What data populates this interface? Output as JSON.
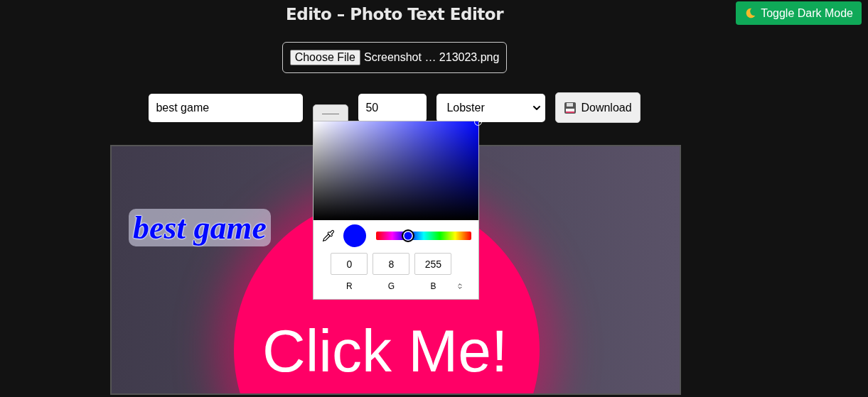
{
  "header": {
    "title": "Edito – Photo Text Editor",
    "theme_button": "Toggle Dark Mode"
  },
  "file_picker": {
    "button": "Choose File",
    "file_name": "Screenshot … 213023.png"
  },
  "toolbar": {
    "text_value": "best game",
    "size_value": "50",
    "font_select": "Lobster",
    "download_button": "Download"
  },
  "color_picker": {
    "color": "#0008ff",
    "hue_slider": {
      "level": 0.33
    },
    "r": "0",
    "g": "8",
    "b": "255",
    "labels": [
      "R",
      "G",
      "B"
    ]
  },
  "canvas": {
    "overlay_text": "best game",
    "image_text": "Click Me!"
  }
}
